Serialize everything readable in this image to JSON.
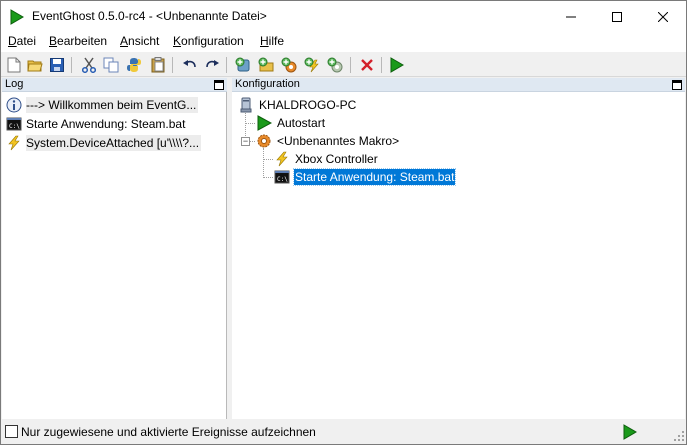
{
  "window": {
    "title": "EventGhost 0.5.0-rc4 - <Unbenannte Datei>",
    "accent_play": "#1a9a1a",
    "selection_color": "#0078d7"
  },
  "title_buttons": {
    "minimize_icon": "minimize-icon",
    "maximize_icon": "maximize-icon",
    "close_icon": "close-icon"
  },
  "menu": [
    {
      "key": "D",
      "rest": "atei"
    },
    {
      "key": "B",
      "rest": "earbeiten"
    },
    {
      "key": "A",
      "rest": "nsicht"
    },
    {
      "key": "K",
      "rest": "onfiguration"
    },
    {
      "key": "H",
      "rest": "ilfe"
    }
  ],
  "toolbar": [
    "new-file-icon",
    "open-folder-icon",
    "save-icon",
    "cut-icon",
    "copy-icon",
    "python-icon",
    "paste-icon",
    "undo-icon",
    "redo-icon",
    "add-plugin-icon",
    "add-folder-icon",
    "add-macro-icon",
    "add-event-icon",
    "add-action-icon",
    "delete-icon",
    "execute-icon"
  ],
  "log": {
    "header": "Log",
    "rows": [
      {
        "icon": "info-icon",
        "text": "---> Willkommen beim EventG..."
      },
      {
        "icon": "console-icon",
        "text": "Starte Anwendung: Steam.bat"
      },
      {
        "icon": "lightning-icon",
        "text": "System.DeviceAttached [u'\\\\\\\\?..."
      }
    ]
  },
  "config": {
    "header": "Konfiguration",
    "root": "KHALDROGO-PC",
    "autostart": "Autostart",
    "macro": "<Unbenanntes Makro>",
    "event": "Xbox Controller",
    "action": "Starte Anwendung: Steam.bat"
  },
  "status": {
    "checkbox_label": "Nur zugewiesene und aktivierte Ereignisse aufzeichnen",
    "checked": false
  }
}
